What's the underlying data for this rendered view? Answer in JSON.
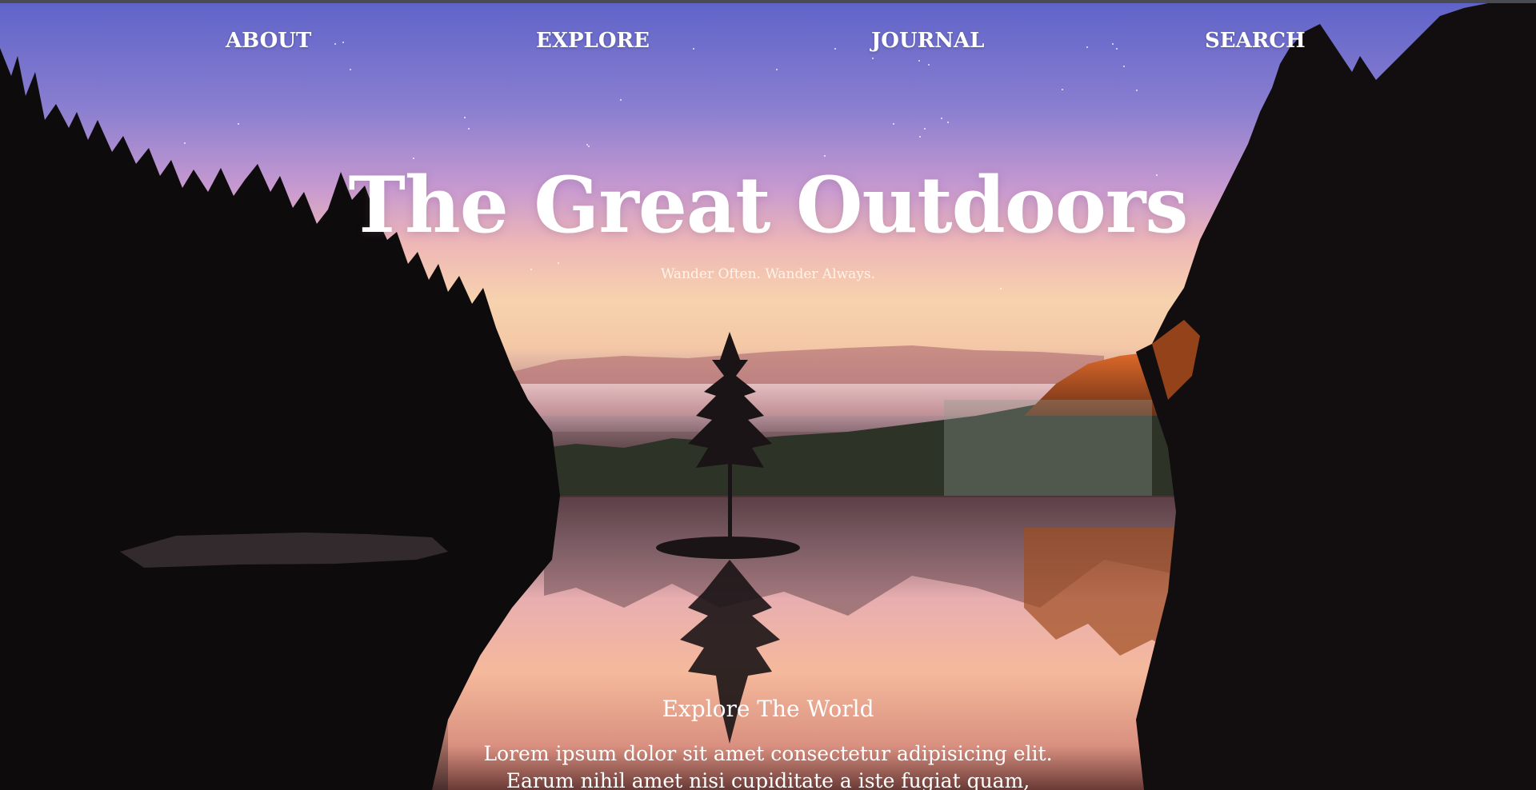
{
  "nav": {
    "items": [
      {
        "label": "ABOUT"
      },
      {
        "label": "EXPLORE"
      },
      {
        "label": "JOURNAL"
      },
      {
        "label": "SEARCH"
      }
    ]
  },
  "hero": {
    "title": "The Great Outdoors",
    "tagline": "Wander Often. Wander Always."
  },
  "section": {
    "heading": "Explore The World",
    "body": "Lorem ipsum dolor sit amet consectetur adipisicing elit. Earum nihil amet nisi cupiditate a iste fugiat quam, repudiandae"
  },
  "colors": {
    "text": "#ffffff",
    "sky_top": "#5e63c9",
    "sky_horizon": "#f7d2ae",
    "forest": "#0d0a0b"
  }
}
